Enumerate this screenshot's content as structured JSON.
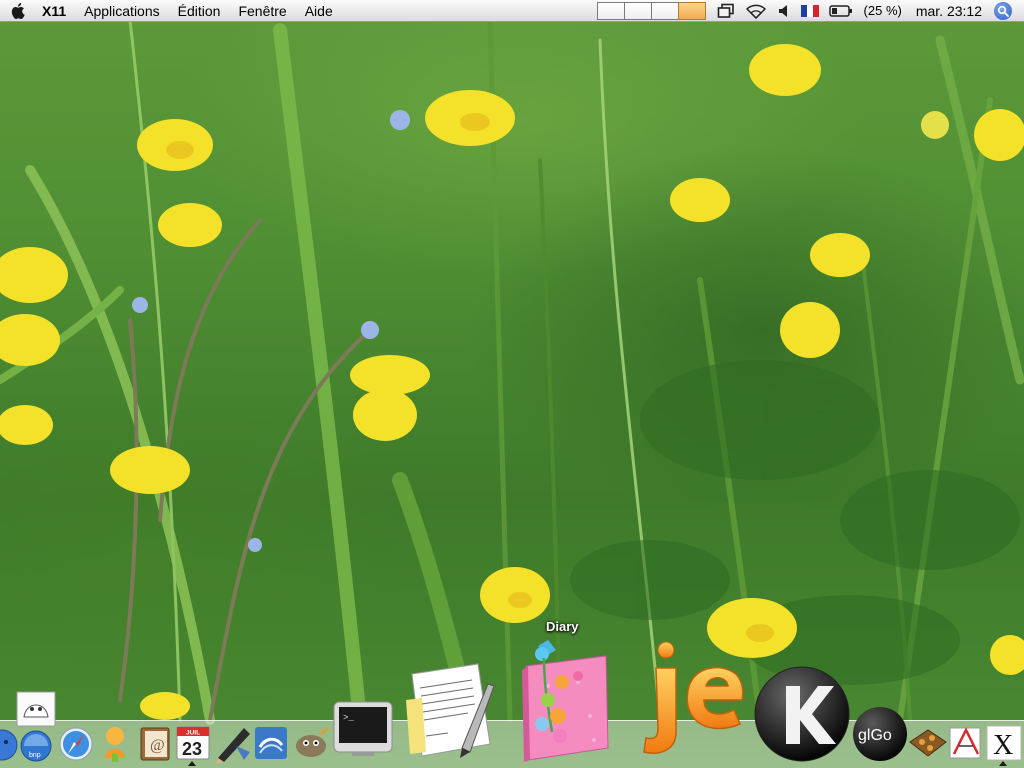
{
  "menubar": {
    "app_name": "X11",
    "menus": [
      "Applications",
      "Édition",
      "Fenêtre",
      "Aide"
    ],
    "status": {
      "battery_percent": "(25 %)",
      "clock": "mar. 23:12",
      "spaces_active_index": 3
    }
  },
  "dock": {
    "hover_label": "Diary",
    "calendar_month": "JUIL",
    "calendar_day": "23",
    "glgo_label": "glGo",
    "x11_label": "X",
    "items": [
      "finder-icon",
      "inkscape-icon",
      "safari-icon",
      "ichat-icon",
      "address-book-icon",
      "ical-icon",
      "pen-app-icon",
      "openoffice-icon",
      "gimp-icon",
      "terminal-icon",
      "textedit-icon",
      "diary-icon",
      "jedit-icon",
      "konsole-icon",
      "glgo-icon",
      "tools-icon",
      "graphing-icon",
      "x11-icon"
    ]
  }
}
